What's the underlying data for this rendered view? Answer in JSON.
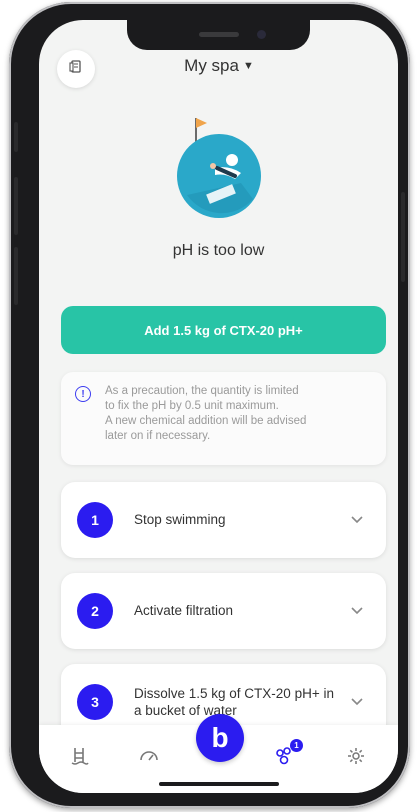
{
  "header": {
    "title": "My spa"
  },
  "status": {
    "message": "pH is too low"
  },
  "action": {
    "label": "Add 1.5 kg of CTX-20 pH+"
  },
  "info": {
    "icon": "info-icon",
    "text": "As a precaution, the quantity is limited\nto fix the pH by 0.5 unit maximum.\nA new chemical addition will be advised\nlater on if necessary."
  },
  "steps": [
    {
      "number": "1",
      "label": "Stop swimming"
    },
    {
      "number": "2",
      "label": "Activate filtration"
    },
    {
      "number": "3",
      "label": "Dissolve 1.5 kg of CTX-20 pH+ in a bucket of water"
    }
  ],
  "nav": {
    "fab_label": "b",
    "badge_count": "1",
    "items": [
      "pool-ladder-icon",
      "gauge-icon",
      "community-icon",
      "settings-icon"
    ]
  },
  "colors": {
    "accent": "#28c4a6",
    "primary": "#2b1cf0",
    "background": "#f3f4f3"
  }
}
